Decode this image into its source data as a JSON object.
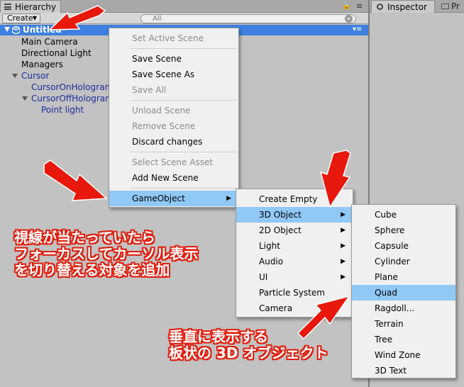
{
  "hierarchy": {
    "tab_label": "Hierarchy",
    "create_label": "Create",
    "search_placeholder": "All",
    "scene_name": "Untitled*",
    "items": [
      {
        "label": "Main Camera"
      },
      {
        "label": "Directional Light"
      },
      {
        "label": "Managers"
      },
      {
        "label": "Cursor"
      },
      {
        "label": "CursorOnHologram"
      },
      {
        "label": "CursorOffHologram"
      },
      {
        "label": "Point light"
      }
    ]
  },
  "inspector": {
    "tab_label": "Inspector",
    "project_tab_label": "Pr"
  },
  "scene_menu": {
    "items": [
      {
        "label": "Set Active Scene",
        "disabled": true
      },
      {
        "label": "Save Scene",
        "disabled": false
      },
      {
        "label": "Save Scene As",
        "disabled": false
      },
      {
        "label": "Save All",
        "disabled": true
      },
      {
        "label": "Unload Scene",
        "disabled": true
      },
      {
        "label": "Remove Scene",
        "disabled": true
      },
      {
        "label": "Discard changes",
        "disabled": false
      },
      {
        "label": "Select Scene Asset",
        "disabled": true
      },
      {
        "label": "Add New Scene",
        "disabled": false
      },
      {
        "label": "GameObject",
        "disabled": false,
        "highlighted": true,
        "submenu": true
      }
    ]
  },
  "gameobject_menu": {
    "items": [
      {
        "label": "Create Empty"
      },
      {
        "label": "3D Object",
        "highlighted": true,
        "submenu": true
      },
      {
        "label": "2D Object",
        "submenu": true
      },
      {
        "label": "Light",
        "submenu": true
      },
      {
        "label": "Audio",
        "submenu": true
      },
      {
        "label": "UI",
        "submenu": true
      },
      {
        "label": "Particle System"
      },
      {
        "label": "Camera"
      }
    ]
  },
  "object3d_menu": {
    "items": [
      {
        "label": "Cube"
      },
      {
        "label": "Sphere"
      },
      {
        "label": "Capsule"
      },
      {
        "label": "Cylinder"
      },
      {
        "label": "Plane"
      },
      {
        "label": "Quad",
        "highlighted": true
      },
      {
        "label": "Ragdoll..."
      },
      {
        "label": "Terrain"
      },
      {
        "label": "Tree"
      },
      {
        "label": "Wind Zone"
      },
      {
        "label": "3D Text"
      }
    ]
  },
  "annotations": {
    "note1": [
      "視線が当たっていたら",
      "フォーカスしてカーソル表示",
      "を切り替える対象を追加"
    ],
    "note2": [
      "垂直に表示する",
      "板状の 3D オブジェクト"
    ]
  },
  "colors": {
    "selection_blue": "#3d80df",
    "menu_highlight": "#90c8f6",
    "annotation_red": "#e02010"
  }
}
